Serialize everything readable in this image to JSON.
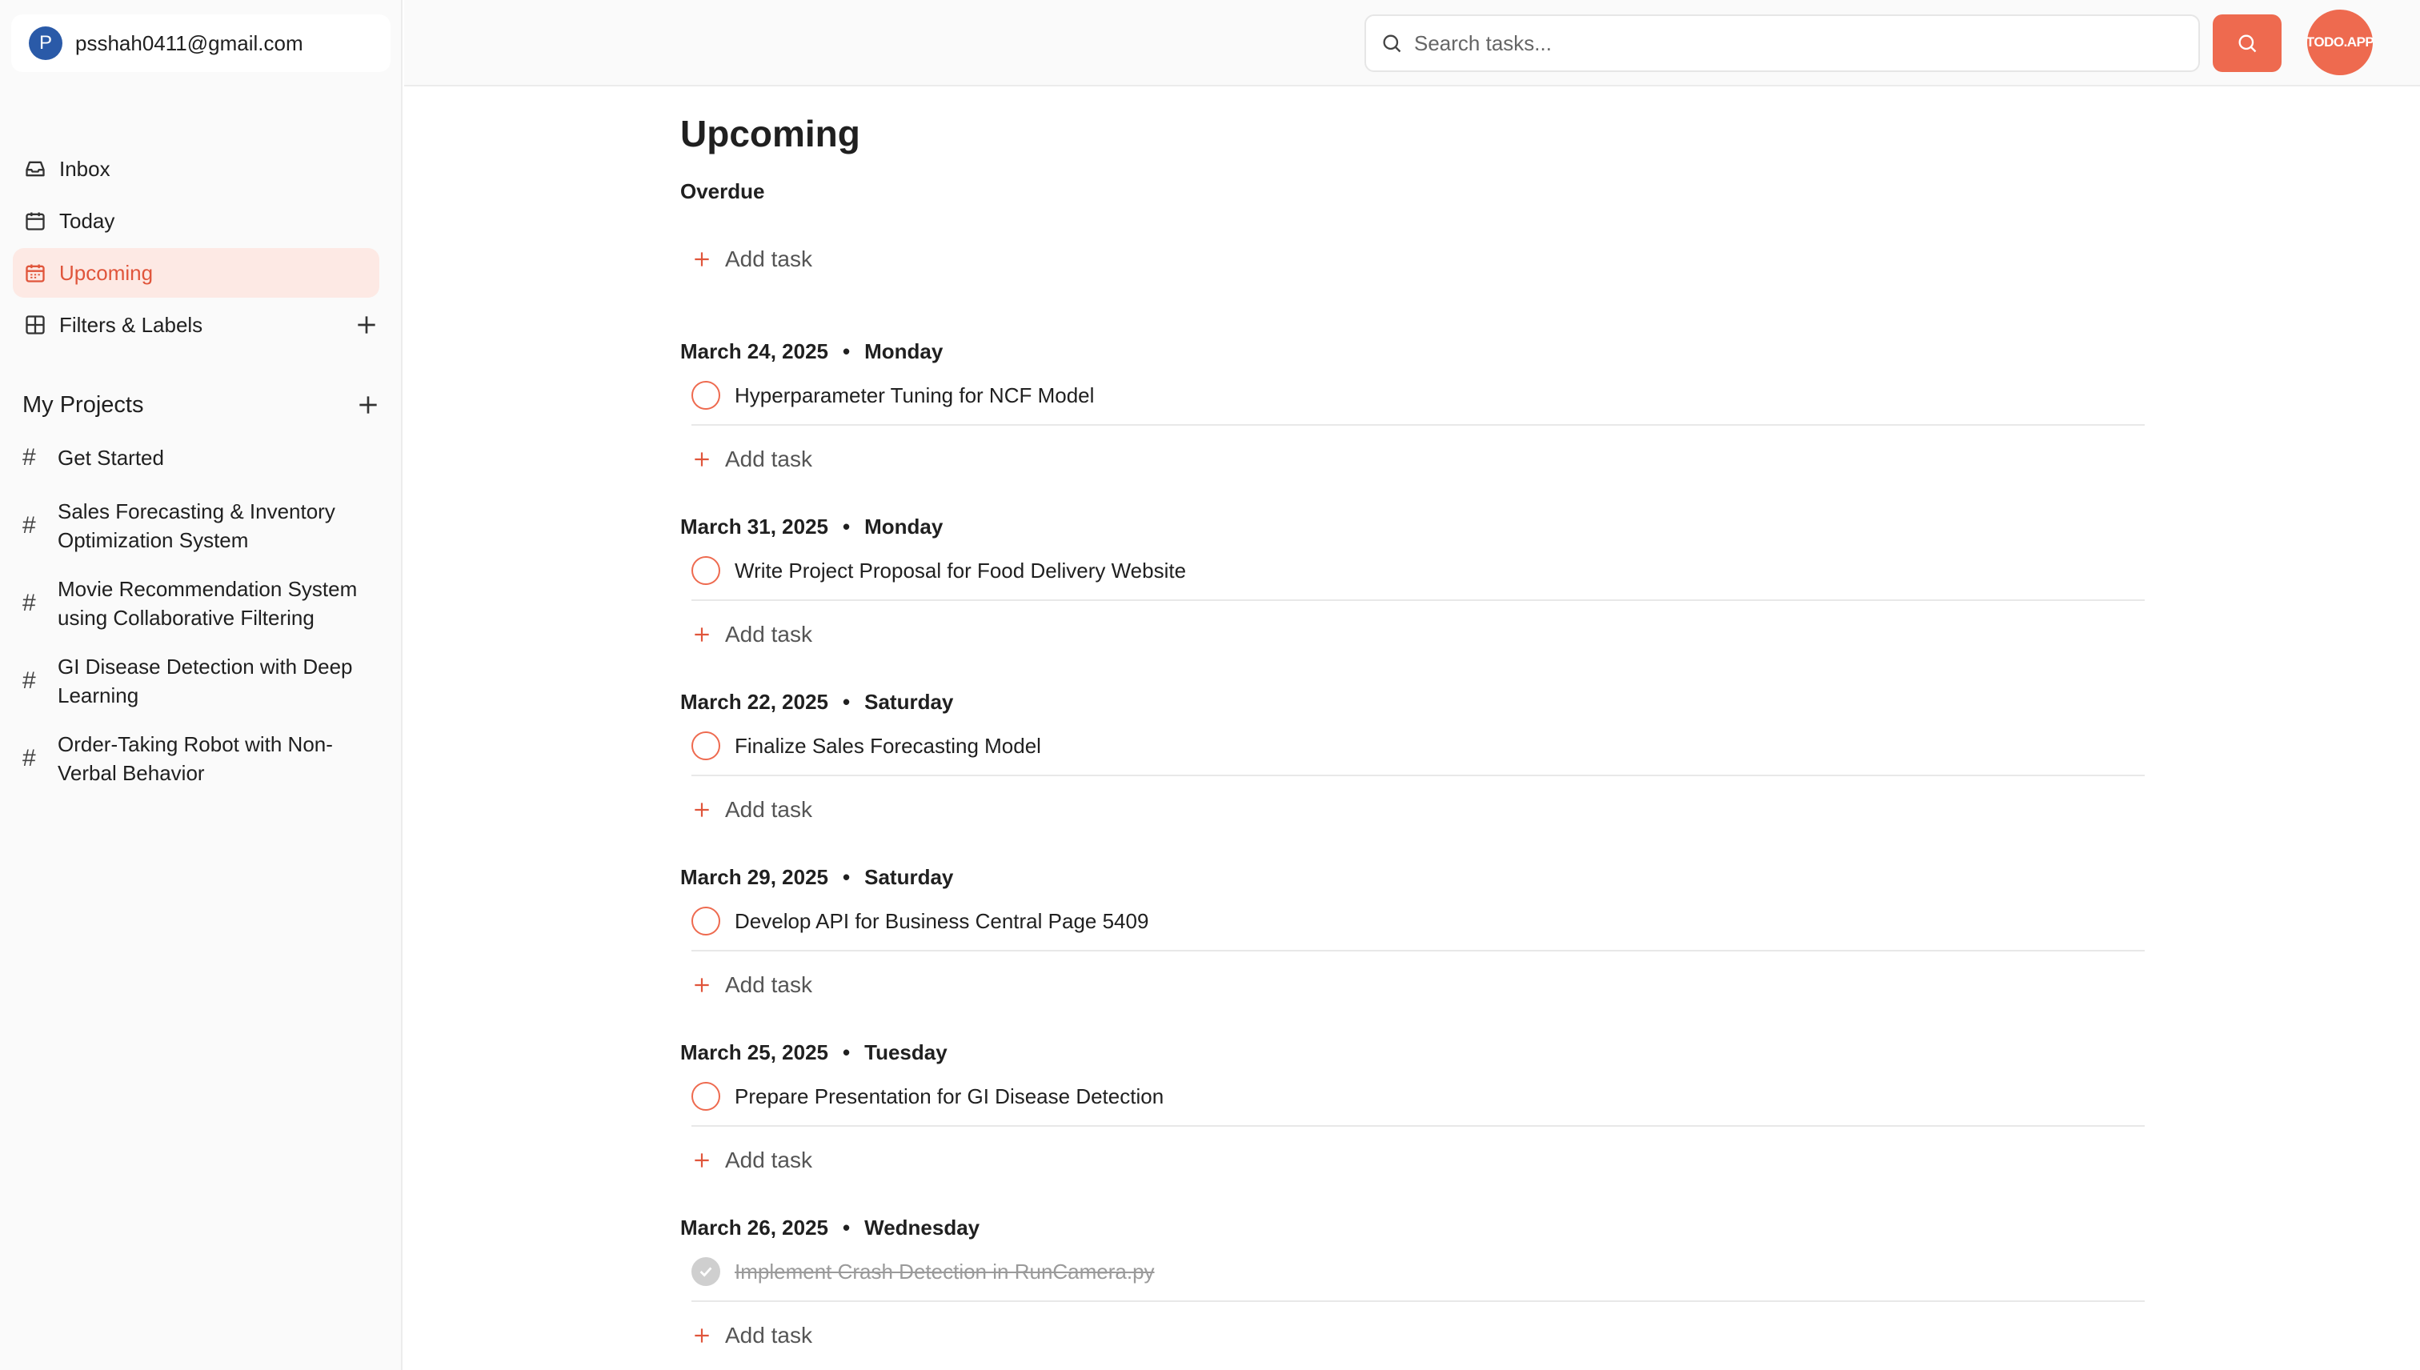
{
  "account": {
    "initial": "P",
    "email": "psshah0411@gmail.com"
  },
  "nav": [
    {
      "label": "Inbox",
      "icon": "inbox-icon",
      "active": false
    },
    {
      "label": "Today",
      "icon": "calendar-icon",
      "active": false
    },
    {
      "label": "Upcoming",
      "icon": "calendar-grid-icon",
      "active": true
    },
    {
      "label": "Filters & Labels",
      "icon": "grid-icon",
      "active": false
    }
  ],
  "projects": {
    "title": "My Projects",
    "items": [
      {
        "label": "Get Started"
      },
      {
        "label": "Sales Forecasting & Inventory Optimization System"
      },
      {
        "label": "Movie Recommendation System using Collaborative Filtering"
      },
      {
        "label": "GI Disease Detection with Deep Learning"
      },
      {
        "label": "Order-Taking Robot with Non-Verbal Behavior"
      }
    ]
  },
  "topbar": {
    "search_placeholder": "Search tasks...",
    "brand": "TODO.APP"
  },
  "colors": {
    "accent": "#ee6a4f",
    "active_bg": "#fde9e4",
    "active_text": "#e0553b"
  },
  "main": {
    "title": "Upcoming",
    "overdue_label": "Overdue",
    "add_task_label": "Add task",
    "sections": [
      {
        "date": "March 24, 2025",
        "day": "Monday",
        "task": "Hyperparameter Tuning for NCF Model",
        "done": false
      },
      {
        "date": "March 31, 2025",
        "day": "Monday",
        "task": "Write Project Proposal for Food Delivery Website",
        "done": false
      },
      {
        "date": "March 22, 2025",
        "day": "Saturday",
        "task": "Finalize Sales Forecasting Model",
        "done": false
      },
      {
        "date": "March 29, 2025",
        "day": "Saturday",
        "task": "Develop API for Business Central Page 5409",
        "done": false
      },
      {
        "date": "March 25, 2025",
        "day": "Tuesday",
        "task": "Prepare Presentation for GI Disease Detection",
        "done": false
      },
      {
        "date": "March 26, 2025",
        "day": "Wednesday",
        "task": "Implement Crash Detection in RunCamera.py",
        "done": true
      }
    ]
  }
}
